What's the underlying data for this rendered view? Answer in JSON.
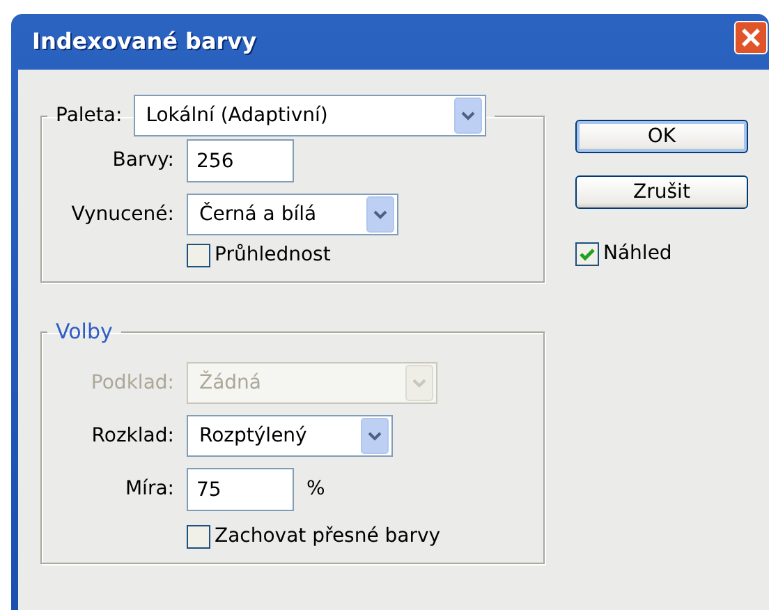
{
  "window": {
    "title": "Indexované barvy"
  },
  "palette_group": {
    "legend": {
      "kind": "select",
      "label": "Paleta:",
      "value": "Lokální (Adaptivní)",
      "disabled": false
    },
    "rows": [
      {
        "kind": "input",
        "label": "Barvy:",
        "value": "256",
        "disabled": false
      },
      {
        "kind": "select",
        "label": "Vynucené:",
        "value": "Černá a bílá",
        "disabled": false
      },
      {
        "kind": "checkbox",
        "label": "Průhlednost",
        "checked": false,
        "disabled": false
      }
    ]
  },
  "options_group": {
    "title": "Volby",
    "rows": [
      {
        "kind": "select",
        "label": "Podklad:",
        "value": "Žádná",
        "disabled": true
      },
      {
        "kind": "select",
        "label": "Rozklad:",
        "value": "Rozptýlený",
        "disabled": false
      },
      {
        "kind": "input",
        "label": "Míra:",
        "value": "75",
        "unit": "%",
        "disabled": false
      },
      {
        "kind": "checkbox",
        "label": "Zachovat přesné barvy",
        "checked": false,
        "disabled": false
      }
    ]
  },
  "buttons": [
    {
      "label": "OK",
      "default": true
    },
    {
      "label": "Zrušit",
      "default": false
    }
  ],
  "preview": {
    "label": "Náhled",
    "checked": true
  }
}
